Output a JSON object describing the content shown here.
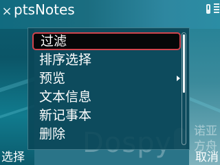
{
  "status_bar": {
    "close_glyph": "×",
    "app_title": "ptsNotes"
  },
  "menu": {
    "items": [
      {
        "label": "过滤",
        "selected": true,
        "has_submenu": false
      },
      {
        "label": "排序选择",
        "selected": false,
        "has_submenu": false
      },
      {
        "label": "预览",
        "selected": false,
        "has_submenu": true
      },
      {
        "label": "文本信息",
        "selected": false,
        "has_submenu": false
      },
      {
        "label": "新记事本",
        "selected": false,
        "has_submenu": false
      },
      {
        "label": "删除",
        "selected": false,
        "has_submenu": false
      }
    ],
    "scroll_position": 0.0,
    "visible_fraction": 0.53
  },
  "softkeys": {
    "left": "选择",
    "right": "取消"
  },
  "watermark": {
    "text": "Dospy",
    "cn_text": "诺亚方舟"
  },
  "colors": {
    "selection_border": "#d2444d",
    "menu_background": "#094656",
    "wallpaper": "#2a7488"
  }
}
